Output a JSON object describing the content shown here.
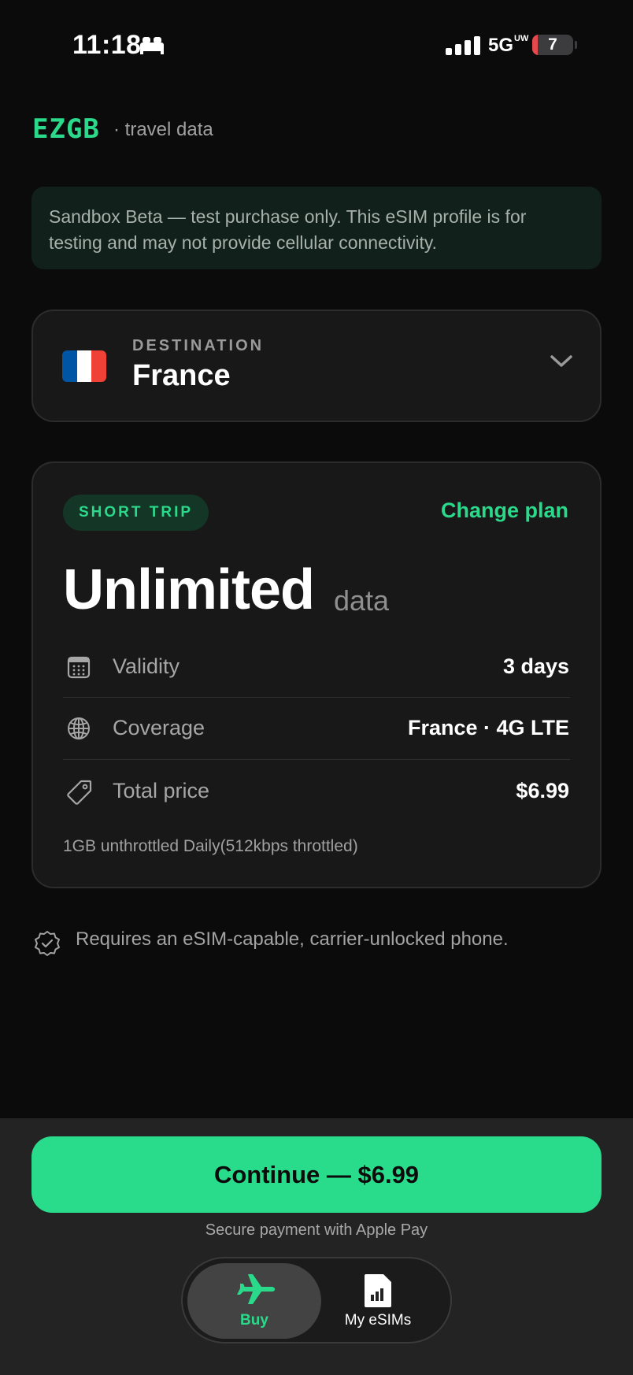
{
  "status_bar": {
    "time": "11:18",
    "network": "5G",
    "network_sup": "UW",
    "battery": "7"
  },
  "brand": {
    "name": "EZGB",
    "tagline": "· travel data"
  },
  "notice": "Sandbox Beta — test purchase only. This eSIM profile is for testing and may not provide cellular connectivity.",
  "destination": {
    "label": "DESTINATION",
    "value": "France",
    "flag_colors": [
      "#0055a4",
      "#ffffff",
      "#ef4135"
    ]
  },
  "plan": {
    "badge": "SHORT TRIP",
    "change_label": "Change plan",
    "amount": "Unlimited",
    "unit": "data",
    "rows": [
      {
        "icon": "calendar-icon",
        "label": "Validity",
        "value": "3 days"
      },
      {
        "icon": "globe-icon",
        "label": "Coverage",
        "value": "France · 4G LTE"
      },
      {
        "icon": "tag-icon",
        "label": "Total price",
        "value": "$6.99"
      }
    ],
    "fine_print": "1GB unthrottled Daily(512kbps throttled)"
  },
  "requirement": "Requires an eSIM-capable, carrier-unlocked phone.",
  "cta": {
    "label": "Continue — $6.99",
    "secure_note": "Secure payment with Apple Pay"
  },
  "tabs": [
    {
      "label": "Buy",
      "icon": "airplane-icon",
      "active": true
    },
    {
      "label": "My eSIMs",
      "icon": "sim-card-icon",
      "active": false
    }
  ],
  "colors": {
    "accent": "#29dc8b",
    "background": "#0b0b0b",
    "card": "#181818"
  }
}
